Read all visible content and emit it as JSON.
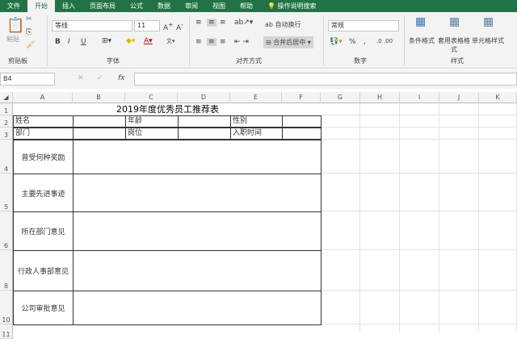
{
  "tabs": [
    "文件",
    "开始",
    "插入",
    "页面布局",
    "公式",
    "数据",
    "审阅",
    "视图",
    "帮助"
  ],
  "search_label": "操作说明搜索",
  "ribbon": {
    "clipboard": {
      "paste": "粘贴",
      "label": "剪贴板"
    },
    "font": {
      "name": "等线",
      "size": "11",
      "label": "字体",
      "bold": "B",
      "italic": "I",
      "underline": "U"
    },
    "alignment": {
      "wrap": "自动换行",
      "merge": "合并后居中",
      "label": "对齐方式"
    },
    "number": {
      "format": "常规",
      "percent": "%",
      "comma": ",",
      "label": "数字"
    },
    "styles": {
      "conditional": "条件格式",
      "table_format": "套用表格格式",
      "cell_styles": "单元格样式",
      "label": "样式"
    }
  },
  "formula_bar": {
    "name_box": "B4",
    "fx": "fx",
    "value": ""
  },
  "columns": [
    "A",
    "B",
    "C",
    "D",
    "E",
    "F",
    "G",
    "H",
    "I",
    "J",
    "K"
  ],
  "rows": [
    "1",
    "2",
    "3",
    "4",
    "5",
    "6",
    "8",
    "10",
    "11"
  ],
  "sheet": {
    "title": "2019年度优秀员工推荐表",
    "r2": [
      "姓名",
      "年龄",
      "性别"
    ],
    "r3": [
      "部门",
      "岗位",
      "入职时间"
    ],
    "sections": [
      "曾受何种奖励",
      "主要先进事迹",
      "所在部门意见",
      "行政人事部意见",
      "公司审批意见"
    ]
  }
}
